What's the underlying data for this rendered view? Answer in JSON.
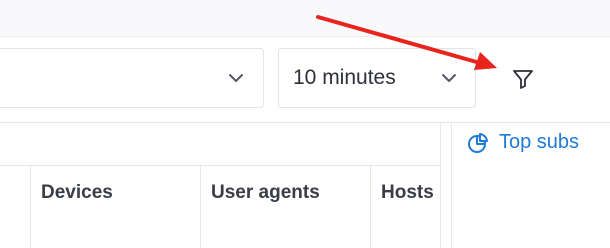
{
  "toolbar": {
    "time_range": {
      "value": "10 minutes"
    },
    "filter_button": {
      "icon": "filter-icon"
    }
  },
  "table": {
    "columns": [
      "Devices",
      "User agents",
      "Hosts"
    ]
  },
  "side_panel": {
    "tab_label": "Top subs",
    "tab_icon": "pie-chart-icon"
  },
  "annotation": {
    "arrow_color": "#e8241d"
  },
  "colors": {
    "accent": "#1f7bd8",
    "text": "#2d2f3a",
    "border": "#e3e4e8"
  }
}
